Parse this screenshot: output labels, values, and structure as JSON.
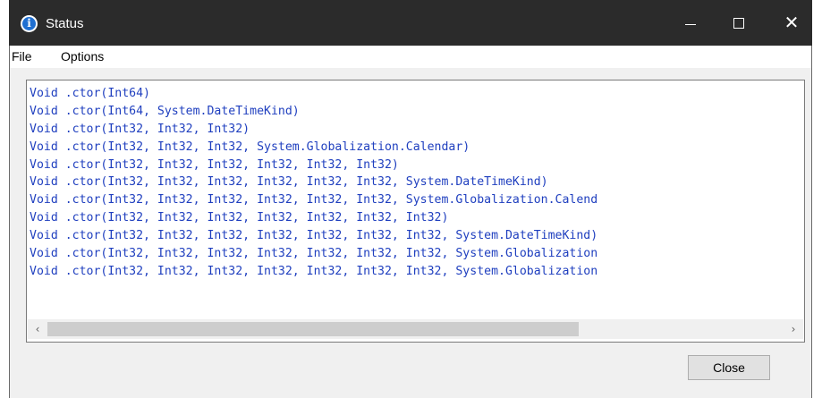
{
  "window": {
    "title": "Status",
    "title_icon": "info-icon",
    "controls": {
      "minimize": "minimize-icon",
      "maximize": "maximize-icon",
      "close": "✕"
    }
  },
  "menu": [
    {
      "label": "File"
    },
    {
      "label": "Options"
    }
  ],
  "output": {
    "text_color": "#1f3fbf",
    "lines": [
      "Void .ctor(Int64)",
      "Void .ctor(Int64, System.DateTimeKind)",
      "Void .ctor(Int32, Int32, Int32)",
      "Void .ctor(Int32, Int32, Int32, System.Globalization.Calendar)",
      "Void .ctor(Int32, Int32, Int32, Int32, Int32, Int32)",
      "Void .ctor(Int32, Int32, Int32, Int32, Int32, Int32, System.DateTimeKind)",
      "Void .ctor(Int32, Int32, Int32, Int32, Int32, Int32, System.Globalization.Calend",
      "Void .ctor(Int32, Int32, Int32, Int32, Int32, Int32, Int32)",
      "Void .ctor(Int32, Int32, Int32, Int32, Int32, Int32, Int32, System.DateTimeKind)",
      "Void .ctor(Int32, Int32, Int32, Int32, Int32, Int32, Int32, System.Globalization",
      "Void .ctor(Int32, Int32, Int32, Int32, Int32, Int32, Int32, System.Globalization"
    ]
  },
  "scrollbar": {
    "left_arrow": "‹",
    "right_arrow": "›"
  },
  "buttons": {
    "close": "Close"
  }
}
